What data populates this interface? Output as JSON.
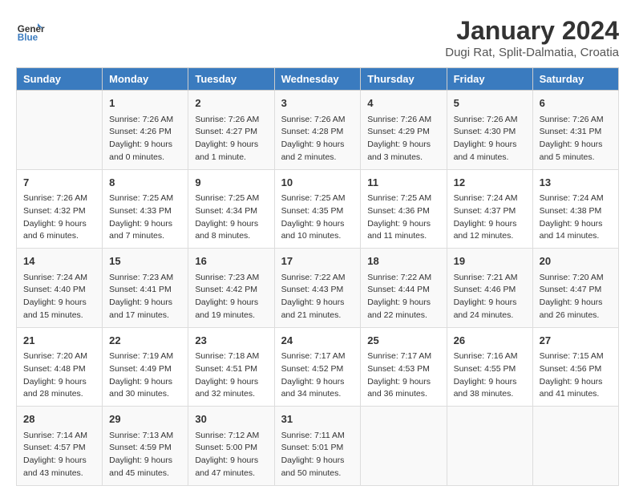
{
  "logo": {
    "text_general": "General",
    "text_blue": "Blue"
  },
  "title": "January 2024",
  "subtitle": "Dugi Rat, Split-Dalmatia, Croatia",
  "header_row": [
    "Sunday",
    "Monday",
    "Tuesday",
    "Wednesday",
    "Thursday",
    "Friday",
    "Saturday"
  ],
  "weeks": [
    [
      {
        "date": "",
        "sunrise": "",
        "sunset": "",
        "daylight": ""
      },
      {
        "date": "1",
        "sunrise": "Sunrise: 7:26 AM",
        "sunset": "Sunset: 4:26 PM",
        "daylight": "Daylight: 9 hours and 0 minutes."
      },
      {
        "date": "2",
        "sunrise": "Sunrise: 7:26 AM",
        "sunset": "Sunset: 4:27 PM",
        "daylight": "Daylight: 9 hours and 1 minute."
      },
      {
        "date": "3",
        "sunrise": "Sunrise: 7:26 AM",
        "sunset": "Sunset: 4:28 PM",
        "daylight": "Daylight: 9 hours and 2 minutes."
      },
      {
        "date": "4",
        "sunrise": "Sunrise: 7:26 AM",
        "sunset": "Sunset: 4:29 PM",
        "daylight": "Daylight: 9 hours and 3 minutes."
      },
      {
        "date": "5",
        "sunrise": "Sunrise: 7:26 AM",
        "sunset": "Sunset: 4:30 PM",
        "daylight": "Daylight: 9 hours and 4 minutes."
      },
      {
        "date": "6",
        "sunrise": "Sunrise: 7:26 AM",
        "sunset": "Sunset: 4:31 PM",
        "daylight": "Daylight: 9 hours and 5 minutes."
      }
    ],
    [
      {
        "date": "7",
        "sunrise": "Sunrise: 7:26 AM",
        "sunset": "Sunset: 4:32 PM",
        "daylight": "Daylight: 9 hours and 6 minutes."
      },
      {
        "date": "8",
        "sunrise": "Sunrise: 7:25 AM",
        "sunset": "Sunset: 4:33 PM",
        "daylight": "Daylight: 9 hours and 7 minutes."
      },
      {
        "date": "9",
        "sunrise": "Sunrise: 7:25 AM",
        "sunset": "Sunset: 4:34 PM",
        "daylight": "Daylight: 9 hours and 8 minutes."
      },
      {
        "date": "10",
        "sunrise": "Sunrise: 7:25 AM",
        "sunset": "Sunset: 4:35 PM",
        "daylight": "Daylight: 9 hours and 10 minutes."
      },
      {
        "date": "11",
        "sunrise": "Sunrise: 7:25 AM",
        "sunset": "Sunset: 4:36 PM",
        "daylight": "Daylight: 9 hours and 11 minutes."
      },
      {
        "date": "12",
        "sunrise": "Sunrise: 7:24 AM",
        "sunset": "Sunset: 4:37 PM",
        "daylight": "Daylight: 9 hours and 12 minutes."
      },
      {
        "date": "13",
        "sunrise": "Sunrise: 7:24 AM",
        "sunset": "Sunset: 4:38 PM",
        "daylight": "Daylight: 9 hours and 14 minutes."
      }
    ],
    [
      {
        "date": "14",
        "sunrise": "Sunrise: 7:24 AM",
        "sunset": "Sunset: 4:40 PM",
        "daylight": "Daylight: 9 hours and 15 minutes."
      },
      {
        "date": "15",
        "sunrise": "Sunrise: 7:23 AM",
        "sunset": "Sunset: 4:41 PM",
        "daylight": "Daylight: 9 hours and 17 minutes."
      },
      {
        "date": "16",
        "sunrise": "Sunrise: 7:23 AM",
        "sunset": "Sunset: 4:42 PM",
        "daylight": "Daylight: 9 hours and 19 minutes."
      },
      {
        "date": "17",
        "sunrise": "Sunrise: 7:22 AM",
        "sunset": "Sunset: 4:43 PM",
        "daylight": "Daylight: 9 hours and 21 minutes."
      },
      {
        "date": "18",
        "sunrise": "Sunrise: 7:22 AM",
        "sunset": "Sunset: 4:44 PM",
        "daylight": "Daylight: 9 hours and 22 minutes."
      },
      {
        "date": "19",
        "sunrise": "Sunrise: 7:21 AM",
        "sunset": "Sunset: 4:46 PM",
        "daylight": "Daylight: 9 hours and 24 minutes."
      },
      {
        "date": "20",
        "sunrise": "Sunrise: 7:20 AM",
        "sunset": "Sunset: 4:47 PM",
        "daylight": "Daylight: 9 hours and 26 minutes."
      }
    ],
    [
      {
        "date": "21",
        "sunrise": "Sunrise: 7:20 AM",
        "sunset": "Sunset: 4:48 PM",
        "daylight": "Daylight: 9 hours and 28 minutes."
      },
      {
        "date": "22",
        "sunrise": "Sunrise: 7:19 AM",
        "sunset": "Sunset: 4:49 PM",
        "daylight": "Daylight: 9 hours and 30 minutes."
      },
      {
        "date": "23",
        "sunrise": "Sunrise: 7:18 AM",
        "sunset": "Sunset: 4:51 PM",
        "daylight": "Daylight: 9 hours and 32 minutes."
      },
      {
        "date": "24",
        "sunrise": "Sunrise: 7:17 AM",
        "sunset": "Sunset: 4:52 PM",
        "daylight": "Daylight: 9 hours and 34 minutes."
      },
      {
        "date": "25",
        "sunrise": "Sunrise: 7:17 AM",
        "sunset": "Sunset: 4:53 PM",
        "daylight": "Daylight: 9 hours and 36 minutes."
      },
      {
        "date": "26",
        "sunrise": "Sunrise: 7:16 AM",
        "sunset": "Sunset: 4:55 PM",
        "daylight": "Daylight: 9 hours and 38 minutes."
      },
      {
        "date": "27",
        "sunrise": "Sunrise: 7:15 AM",
        "sunset": "Sunset: 4:56 PM",
        "daylight": "Daylight: 9 hours and 41 minutes."
      }
    ],
    [
      {
        "date": "28",
        "sunrise": "Sunrise: 7:14 AM",
        "sunset": "Sunset: 4:57 PM",
        "daylight": "Daylight: 9 hours and 43 minutes."
      },
      {
        "date": "29",
        "sunrise": "Sunrise: 7:13 AM",
        "sunset": "Sunset: 4:59 PM",
        "daylight": "Daylight: 9 hours and 45 minutes."
      },
      {
        "date": "30",
        "sunrise": "Sunrise: 7:12 AM",
        "sunset": "Sunset: 5:00 PM",
        "daylight": "Daylight: 9 hours and 47 minutes."
      },
      {
        "date": "31",
        "sunrise": "Sunrise: 7:11 AM",
        "sunset": "Sunset: 5:01 PM",
        "daylight": "Daylight: 9 hours and 50 minutes."
      },
      {
        "date": "",
        "sunrise": "",
        "sunset": "",
        "daylight": ""
      },
      {
        "date": "",
        "sunrise": "",
        "sunset": "",
        "daylight": ""
      },
      {
        "date": "",
        "sunrise": "",
        "sunset": "",
        "daylight": ""
      }
    ]
  ]
}
